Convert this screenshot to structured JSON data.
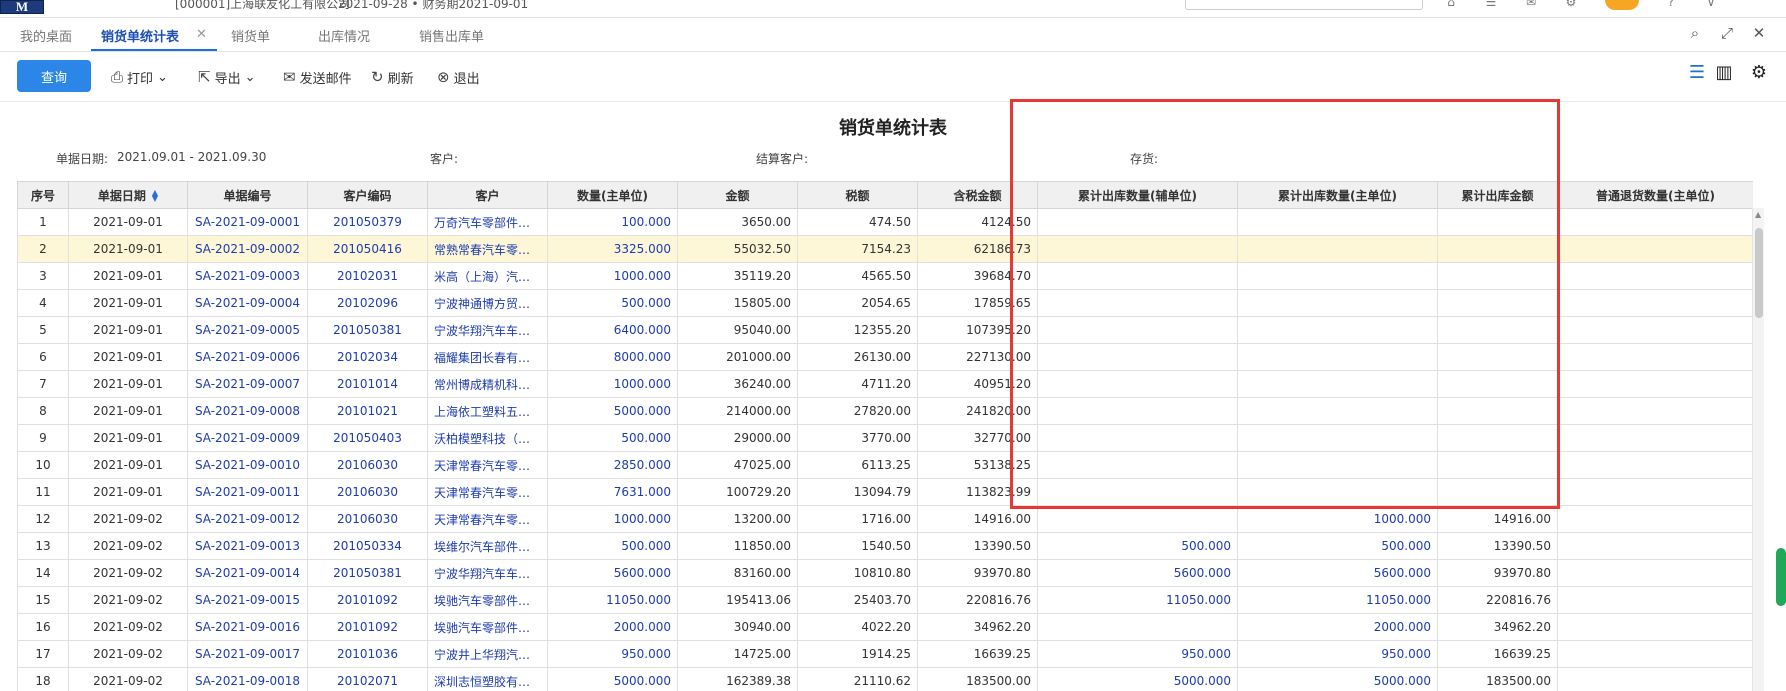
{
  "header": {
    "company_partial": "[000001]上海联友化工有限公司",
    "date_partial": "2021-09-28 • 财务期2021-09-01"
  },
  "tabs": [
    {
      "label": "我的桌面"
    },
    {
      "label": "销货单统计表"
    },
    {
      "label": "销货单"
    },
    {
      "label": "出库情况"
    },
    {
      "label": "销售出库单"
    }
  ],
  "toolbar": {
    "query": "查询",
    "print": "打印",
    "export": "导出",
    "send_mail": "发送邮件",
    "refresh": "刷新",
    "exit": "退出"
  },
  "report": {
    "title": "销货单统计表",
    "filters": {
      "date_label": "单据日期:",
      "date_value": "2021.09.01 - 2021.09.30",
      "customer_label": "客户:",
      "settle_customer_label": "结算客户:",
      "inventory_label": "存货:"
    }
  },
  "table": {
    "columns": [
      "序号",
      "单据日期",
      "单据编号",
      "客户编码",
      "客户",
      "数量(主单位)",
      "金额",
      "税额",
      "含税金额",
      "累计出库数量(辅单位)",
      "累计出库数量(主单位)",
      "累计出库金额",
      "普通退货数量(主单位)"
    ],
    "rows": [
      [
        "1",
        "2021-09-01",
        "SA-2021-09-0001",
        "201050379",
        "万奇汽车零部件…",
        "100.000",
        "3650.00",
        "474.50",
        "4124.50",
        "",
        "",
        "",
        ""
      ],
      [
        "2",
        "2021-09-01",
        "SA-2021-09-0002",
        "201050416",
        "常熟常春汽车零…",
        "3325.000",
        "55032.50",
        "7154.23",
        "62186.73",
        "",
        "",
        "",
        ""
      ],
      [
        "3",
        "2021-09-01",
        "SA-2021-09-0003",
        "20102031",
        "米高（上海）汽…",
        "1000.000",
        "35119.20",
        "4565.50",
        "39684.70",
        "",
        "",
        "",
        ""
      ],
      [
        "4",
        "2021-09-01",
        "SA-2021-09-0004",
        "20102096",
        "宁波神通博方贸…",
        "500.000",
        "15805.00",
        "2054.65",
        "17859.65",
        "",
        "",
        "",
        ""
      ],
      [
        "5",
        "2021-09-01",
        "SA-2021-09-0005",
        "201050381",
        "宁波华翔汽车车…",
        "6400.000",
        "95040.00",
        "12355.20",
        "107395.20",
        "",
        "",
        "",
        ""
      ],
      [
        "6",
        "2021-09-01",
        "SA-2021-09-0006",
        "20102034",
        "福耀集团长春有…",
        "8000.000",
        "201000.00",
        "26130.00",
        "227130.00",
        "",
        "",
        "",
        ""
      ],
      [
        "7",
        "2021-09-01",
        "SA-2021-09-0007",
        "20101014",
        "常州博成精机科…",
        "1000.000",
        "36240.00",
        "4711.20",
        "40951.20",
        "",
        "",
        "",
        ""
      ],
      [
        "8",
        "2021-09-01",
        "SA-2021-09-0008",
        "20101021",
        "上海依工塑料五…",
        "5000.000",
        "214000.00",
        "27820.00",
        "241820.00",
        "",
        "",
        "",
        ""
      ],
      [
        "9",
        "2021-09-01",
        "SA-2021-09-0009",
        "201050403",
        "沃柏模塑科技（…",
        "500.000",
        "29000.00",
        "3770.00",
        "32770.00",
        "",
        "",
        "",
        ""
      ],
      [
        "10",
        "2021-09-01",
        "SA-2021-09-0010",
        "20106030",
        "天津常春汽车零…",
        "2850.000",
        "47025.00",
        "6113.25",
        "53138.25",
        "",
        "",
        "",
        ""
      ],
      [
        "11",
        "2021-09-01",
        "SA-2021-09-0011",
        "20106030",
        "天津常春汽车零…",
        "7631.000",
        "100729.20",
        "13094.79",
        "113823.99",
        "",
        "",
        "",
        ""
      ],
      [
        "12",
        "2021-09-02",
        "SA-2021-09-0012",
        "20106030",
        "天津常春汽车零…",
        "1000.000",
        "13200.00",
        "1716.00",
        "14916.00",
        "",
        "1000.000",
        "14916.00",
        ""
      ],
      [
        "13",
        "2021-09-02",
        "SA-2021-09-0013",
        "201050334",
        "埃维尔汽车部件…",
        "500.000",
        "11850.00",
        "1540.50",
        "13390.50",
        "500.000",
        "500.000",
        "13390.50",
        ""
      ],
      [
        "14",
        "2021-09-02",
        "SA-2021-09-0014",
        "201050381",
        "宁波华翔汽车车…",
        "5600.000",
        "83160.00",
        "10810.80",
        "93970.80",
        "5600.000",
        "5600.000",
        "93970.80",
        ""
      ],
      [
        "15",
        "2021-09-02",
        "SA-2021-09-0015",
        "20101092",
        "埃驰汽车零部件…",
        "11050.000",
        "195413.06",
        "25403.70",
        "220816.76",
        "11050.000",
        "11050.000",
        "220816.76",
        ""
      ],
      [
        "16",
        "2021-09-02",
        "SA-2021-09-0016",
        "20101092",
        "埃驰汽车零部件…",
        "2000.000",
        "30940.00",
        "4022.20",
        "34962.20",
        "",
        "2000.000",
        "34962.20",
        ""
      ],
      [
        "17",
        "2021-09-02",
        "SA-2021-09-0017",
        "20101036",
        "宁波井上华翔汽…",
        "950.000",
        "14725.00",
        "1914.25",
        "16639.25",
        "950.000",
        "950.000",
        "16639.25",
        ""
      ],
      [
        "18",
        "2021-09-02",
        "SA-2021-09-0018",
        "20102071",
        "深圳志恒塑胶有…",
        "5000.000",
        "162389.38",
        "21110.62",
        "183500.00",
        "5000.000",
        "5000.000",
        "183500.00",
        ""
      ]
    ],
    "selected_row": 2
  },
  "colors": {
    "accent": "#2b86e8",
    "link": "#1d3cb0",
    "selected_row": "#fdf7d8",
    "highlight": "#e53935"
  }
}
